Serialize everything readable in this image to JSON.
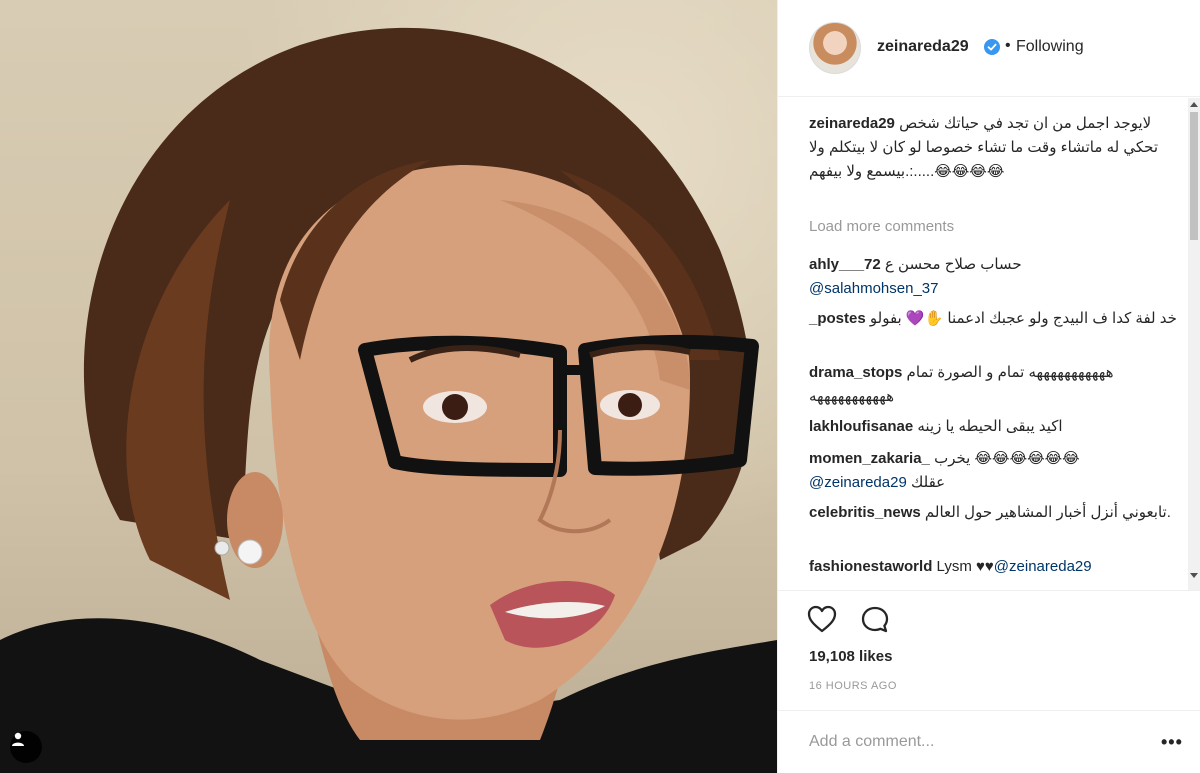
{
  "header": {
    "username": "zeinareda29",
    "separator": "•",
    "follow_status": "Following"
  },
  "caption": {
    "username": "zeinareda29",
    "text": "لايوجد اجمل من ان تجد في حياتك شخص تحكي له ماتشاء وقت ما تشاء خصوصا لو كان لا بيتكلم ولا بيسمع ولا بيفهم.:.....😂😂😂😂"
  },
  "load_more_label": "Load more comments",
  "comments": [
    {
      "username": "ahly___72",
      "text": "حساب صلاح محسن ع",
      "mention": "@salahmohsen_37"
    },
    {
      "username": "_postes",
      "text": "خد لفة كدا ف البيدج ولو عجبك ادعمنا ✋💜 بفولو"
    },
    {
      "username": "drama_stops",
      "text": "هههههههههههه تمام و الصورة تمام هههههههههههه"
    },
    {
      "username": "lakhloufisanae",
      "text": "اكيد يبقى الحيطه يا زينه"
    },
    {
      "username": "momen_zakaria_",
      "text": "يخرب 😂😂😂😂😂😂",
      "mention": "@zeinareda29",
      "tail": "عقلك"
    },
    {
      "username": "celebritis_news",
      "text": "تابعوني أنزل أخبار المشاهير حول العالم."
    },
    {
      "username": "fashionestaworld",
      "text": "Lysm ♥♥",
      "mention": "@zeinareda29"
    }
  ],
  "likes": "19,108 likes",
  "timestamp": "16 HOURS AGO",
  "add_comment_placeholder": "Add a comment...",
  "more_options": "•••",
  "icons": {
    "verified": "verified-badge-icon",
    "heart": "heart-icon",
    "comment": "comment-icon",
    "user_tag": "user-tag-icon"
  },
  "colors": {
    "text": "#262626",
    "muted": "#999999",
    "mention": "#003569",
    "verified": "#3897f0",
    "border": "#efefef"
  }
}
